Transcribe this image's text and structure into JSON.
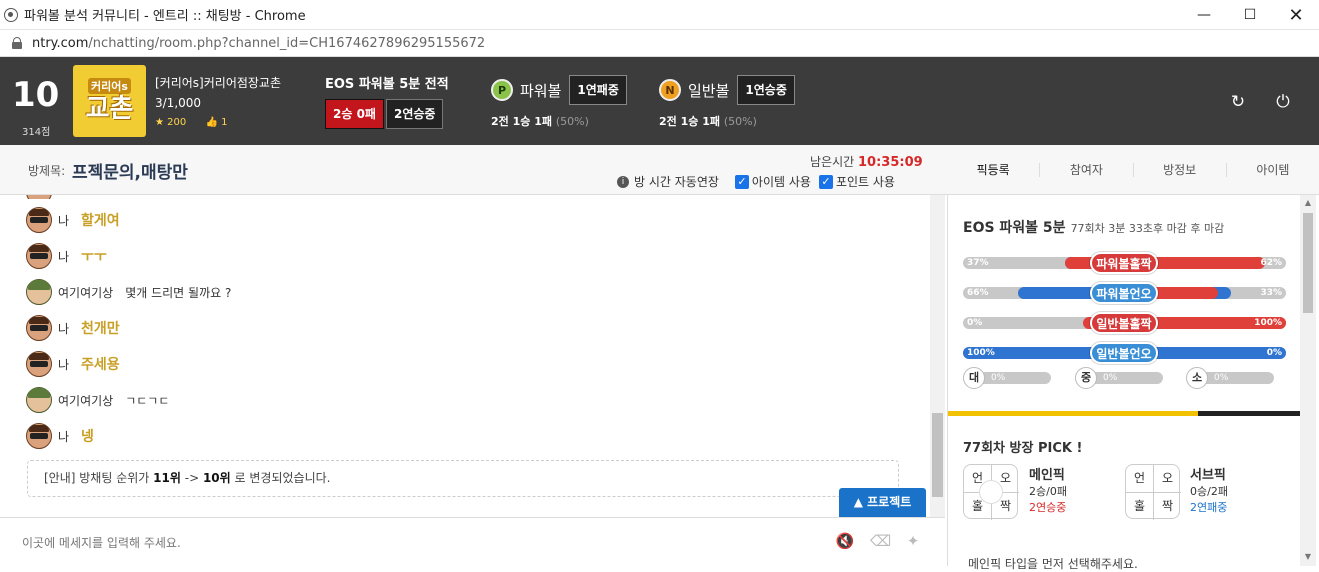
{
  "window": {
    "title": "파워볼 분석 커뮤니티 - 엔트리 :: 채팅방 - Chrome"
  },
  "address": {
    "host": "ntry.com",
    "path": "/nchatting/room.php?channel_id=CH1674627896295155672"
  },
  "header": {
    "rank": "10",
    "rank_points": "314점",
    "room_image_top": "커리어s",
    "room_image_main": "교촌",
    "room_name": "[커리어s]커리어점장교촌",
    "room_members": "3/1,000",
    "star_count": "200",
    "like_count": "1",
    "eos_title": "EOS 파워볼 5분 전적",
    "eos_record": "2승 0패",
    "eos_streak": "2연승중",
    "powerball": {
      "icon": "P",
      "name": "파워볼",
      "streak": "1연패중",
      "summary": "2전 1승 1패",
      "rate": "(50%)"
    },
    "normalball": {
      "icon": "N",
      "name": "일반볼",
      "streak": "1연승중",
      "summary": "2전 1승 1패",
      "rate": "(50%)"
    },
    "accent_red": "#c3161c"
  },
  "subheader": {
    "title_label": "방제목:",
    "title": "프젝문의,매탕만",
    "remain_label": "남은시간",
    "remain_time": "10:35:09",
    "auto_extend": "방 시간 자동연장",
    "use_item": "아이템 사용",
    "use_point": "포인트 사용"
  },
  "tabs": [
    "픽등록",
    "참여자",
    "방정보",
    "아이템"
  ],
  "chat": {
    "messages": [
      {
        "nick": "나",
        "text": "할게여",
        "mine": true
      },
      {
        "nick": "나",
        "text": "ㅜㅜ",
        "mine": true
      },
      {
        "nick": "여기여기상",
        "text": "몇개 드리면 될까요 ?",
        "mine": false
      },
      {
        "nick": "나",
        "text": "천개만",
        "mine": true
      },
      {
        "nick": "나",
        "text": "주세용",
        "mine": true
      },
      {
        "nick": "여기여기상",
        "text": "ㄱㄷㄱㄷ",
        "mine": false
      },
      {
        "nick": "나",
        "text": "넹",
        "mine": true
      }
    ],
    "notice_prefix": "[안내] 방채팅 순위가",
    "notice_from": "11위",
    "notice_arrow": "->",
    "notice_to": "10위",
    "notice_suffix": "로 변경되었습니다.",
    "project_button": "▲ 프로젝트",
    "input_placeholder": "이곳에 메세지를 입력해 주세요."
  },
  "panel": {
    "title": "EOS 파워볼 5분",
    "round_info": "77회차 3분 33초후 마감 후 마감",
    "bars": [
      {
        "label": "파워볼홀짝",
        "left": "37%",
        "right": "62%",
        "left_value": 37,
        "right_value": 62,
        "label_color": "#d63a3a"
      },
      {
        "label": "파워볼언오",
        "left": "66%",
        "right": "33%",
        "left_value": 66,
        "right_value": 33,
        "label_color": "#3a8ed6"
      },
      {
        "label": "일반볼홀짝",
        "left": "0%",
        "right": "100%",
        "left_value": 0,
        "right_value": 100,
        "label_color": "#d63a3a"
      },
      {
        "label": "일반볼언오",
        "left": "100%",
        "right": "0%",
        "left_value": 100,
        "right_value": 0,
        "label_color": "#3a8ed6"
      }
    ],
    "sizes": [
      {
        "icon": "대",
        "value": "0%"
      },
      {
        "icon": "중",
        "value": "0%"
      },
      {
        "icon": "소",
        "value": "0%"
      }
    ],
    "pick_title": "77회차 방장 PICK !",
    "main_pick": {
      "name": "메인픽",
      "record": "2승/0패",
      "streak": "2연승중",
      "streak_color": "#d62828",
      "cells": [
        "언",
        "오",
        "홀",
        "짝"
      ]
    },
    "sub_pick": {
      "name": "서브픽",
      "record": "0승/2패",
      "streak": "2연패중",
      "streak_color": "#1a73c8",
      "cells": [
        "언",
        "오",
        "홀",
        "짝"
      ]
    },
    "footer_text": "메인픽 타입을 먼저 선택해주세요."
  }
}
